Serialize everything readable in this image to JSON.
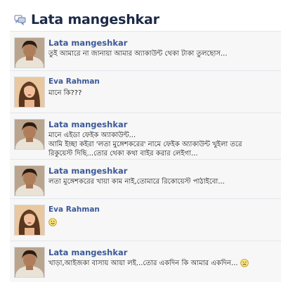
{
  "title": {
    "icon": "chat-bubbles-icon",
    "text": "Lata mangeshkar"
  },
  "messages": [
    {
      "author": "Lata mangeshkar",
      "avatar": "lata-avatar",
      "lines": [
        "তুই আমারে না জানায়া আমার অ্যাকাউন্ট থেকা টাকা তুলছোস..."
      ]
    },
    {
      "author": "Eva Rahman",
      "avatar": "eva-avatar",
      "lines": [
        "মানে কি???"
      ]
    },
    {
      "author": "Lata mangeshkar",
      "avatar": "lata-avatar",
      "lines": [
        "মানে এইডা ফেইক অ্যাকাউন্ট...",
        "আমি ইচ্ছা কইরা 'লতা মুঙ্গেশকরের' নামে ফেইক অ্যাকাউন্ট খুইলা তরে",
        "রিকুয়েস্ট দিছি...তোর থেকা কথা বাইর করার লেইগা..."
      ]
    },
    {
      "author": "Lata mangeshkar",
      "avatar": "lata-avatar",
      "lines": [
        "লতা মুঙ্গেশকরের খায়া কাম নাই,তোমারে রিকোয়েস্ট পাঠাইবো..."
      ]
    },
    {
      "author": "Eva Rahman",
      "avatar": "eva-avatar",
      "emoticon": "smile-icon",
      "lines": []
    },
    {
      "author": "Lata mangeshkar",
      "avatar": "lata-avatar",
      "emoticon_inline": "sad-face-icon",
      "lines": [
        "খাড়া,আইজকা বাসায় আয়া লই...তোর একদিন কি আমার একদিন..."
      ]
    }
  ],
  "colors": {
    "title": "#1c2a47",
    "author": "#3b5998",
    "body_text": "#222222",
    "row_bg": "#f7f7f7",
    "divider": "#e2e6ee"
  }
}
